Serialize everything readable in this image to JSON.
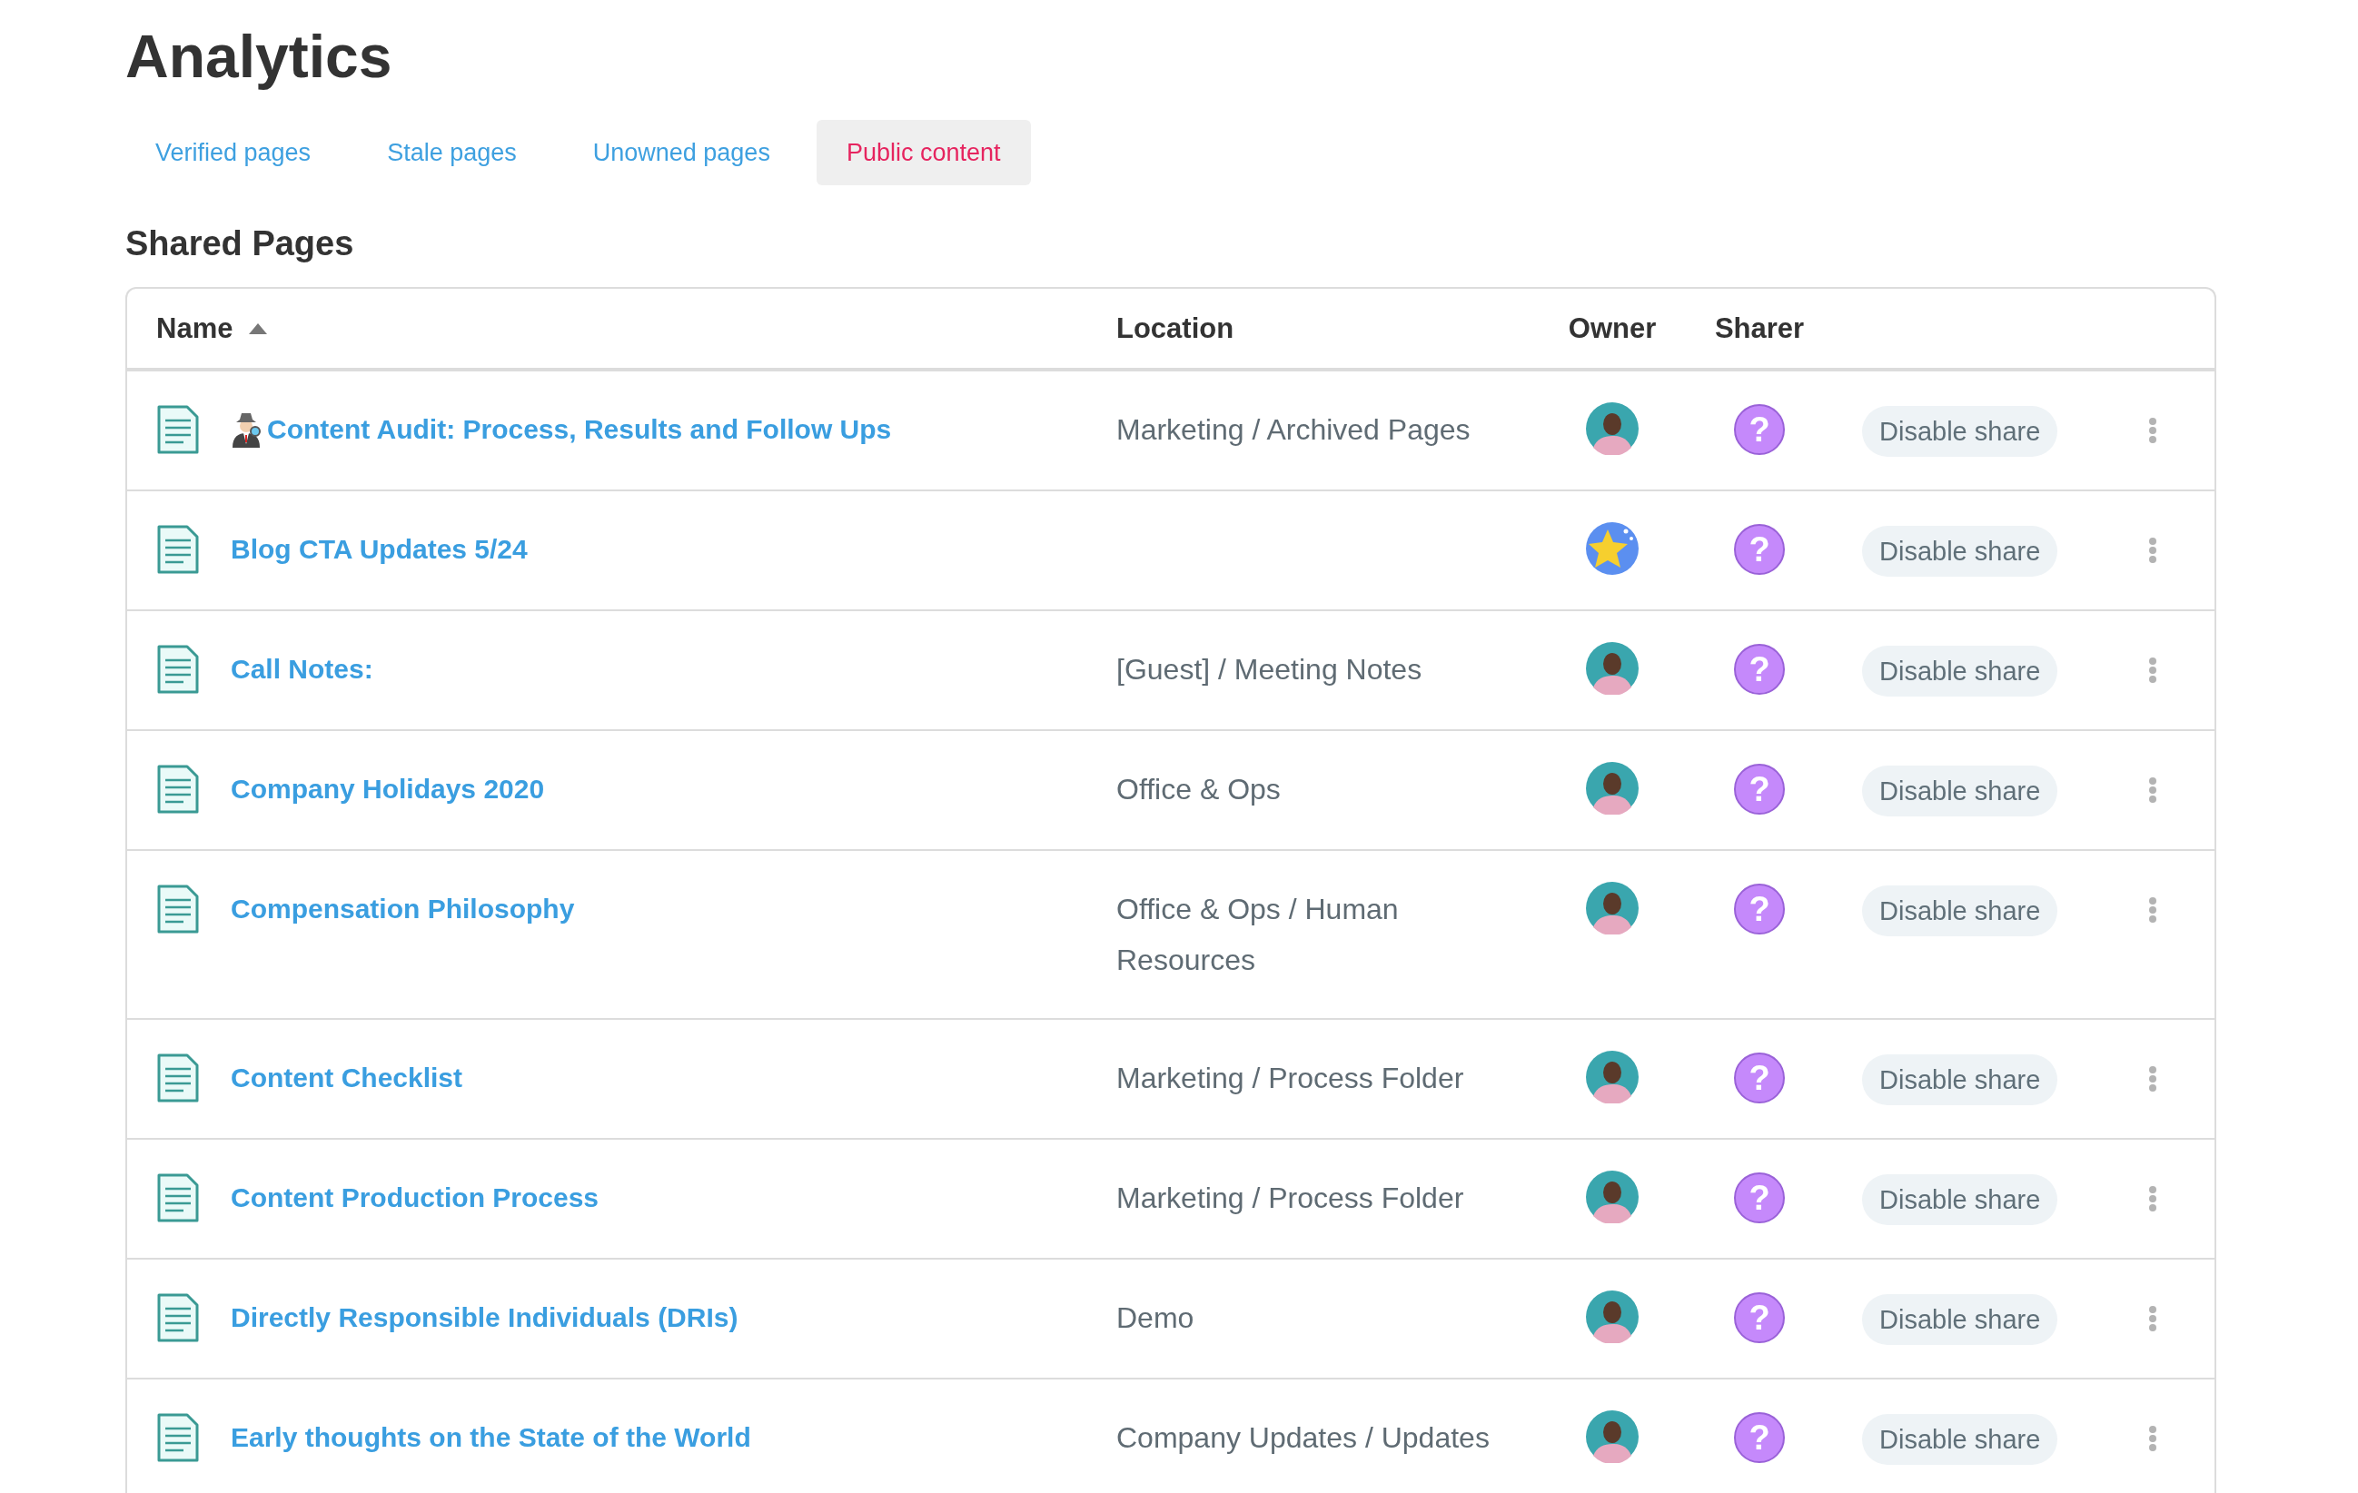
{
  "title": "Analytics",
  "tabs": [
    {
      "label": "Verified pages",
      "selected": false
    },
    {
      "label": "Stale pages",
      "selected": false
    },
    {
      "label": "Unowned pages",
      "selected": false
    },
    {
      "label": "Public content",
      "selected": true
    }
  ],
  "section_title": "Shared Pages",
  "table": {
    "columns": [
      {
        "label": "Name",
        "sort": {
          "kind": "ascending"
        }
      },
      {
        "label": "Location"
      },
      {
        "label": "Owner"
      },
      {
        "label": "Sharer"
      }
    ],
    "rows": [
      {
        "name": "Content Audit: Process, Results and Follow Ups",
        "prefix_icon": {
          "kind": "detective"
        },
        "location": "Marketing / Archived Pages",
        "owner": {
          "kind": "person"
        },
        "sharer": "?",
        "action": "Disable share"
      },
      {
        "name": "Blog CTA Updates 5/24",
        "owner": {
          "kind": "star"
        },
        "sharer": "?",
        "action": "Disable share"
      },
      {
        "name": "Call Notes:",
        "location": "[Guest] / Meeting Notes",
        "owner": {
          "kind": "person"
        },
        "sharer": "?",
        "action": "Disable share"
      },
      {
        "name": "Company Holidays 2020",
        "location": "Office & Ops",
        "owner": {
          "kind": "person"
        },
        "sharer": "?",
        "action": "Disable share"
      },
      {
        "name": "Compensation Philosophy",
        "location": "Office & Ops / Human Resources",
        "owner": {
          "kind": "person"
        },
        "sharer": "?",
        "action": "Disable share"
      },
      {
        "name": "Content Checklist",
        "location": "Marketing / Process Folder",
        "owner": {
          "kind": "person"
        },
        "sharer": "?",
        "action": "Disable share"
      },
      {
        "name": "Content Production Process",
        "location": "Marketing / Process Folder",
        "owner": {
          "kind": "person"
        },
        "sharer": "?",
        "action": "Disable share"
      },
      {
        "name": "Directly Responsible Individuals (DRIs)",
        "location": "Demo",
        "owner": {
          "kind": "person"
        },
        "sharer": "?",
        "action": "Disable share"
      },
      {
        "name": "Early thoughts on the State of the World",
        "location": "Company Updates / Updates",
        "owner": {
          "kind": "person"
        },
        "sharer": "?",
        "action": "Disable share"
      }
    ]
  }
}
